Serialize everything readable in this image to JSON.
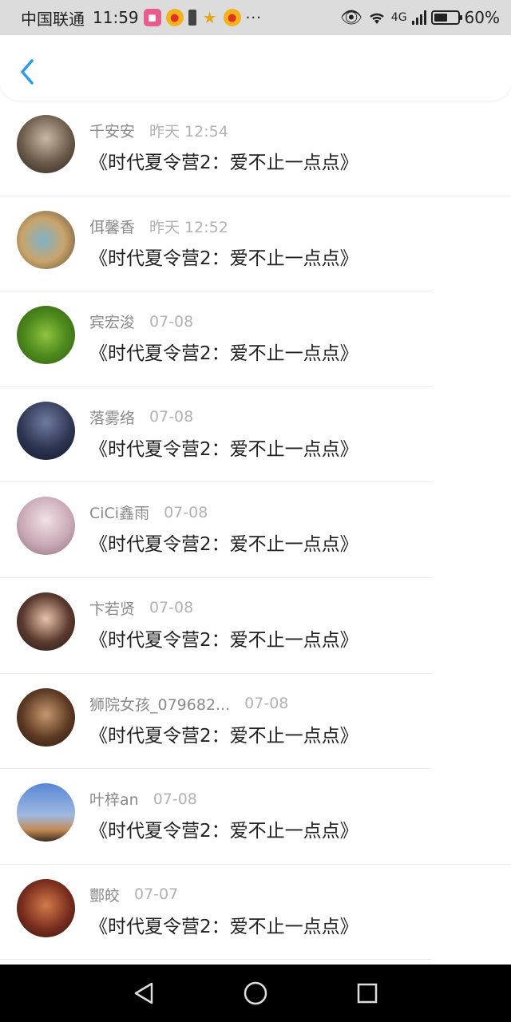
{
  "status_bar": {
    "carrier": "中国联通",
    "time": "11:59",
    "network": "4G",
    "battery_percent": 0.6,
    "battery_text": "60%",
    "more_dots": "···"
  },
  "header": {
    "back_icon": "chevron-left-icon",
    "accent_color": "#2d9be8"
  },
  "comments": [
    {
      "user": "千安安",
      "time": "昨天 12:54",
      "title": "《时代夏令营2：爱不止一点点》"
    },
    {
      "user": "佴馨香",
      "time": "昨天 12:52",
      "title": "《时代夏令营2：爱不止一点点》"
    },
    {
      "user": "宾宏浚",
      "time": "07-08",
      "title": "《时代夏令营2：爱不止一点点》"
    },
    {
      "user": "落雾络",
      "time": "07-08",
      "title": "《时代夏令营2：爱不止一点点》"
    },
    {
      "user": "CiCi鑫雨",
      "time": "07-08",
      "title": "《时代夏令营2：爱不止一点点》"
    },
    {
      "user": "卞若贤",
      "time": "07-08",
      "title": "《时代夏令营2：爱不止一点点》"
    },
    {
      "user": "狮院女孩_079682...",
      "time": "07-08",
      "title": "《时代夏令营2：爱不止一点点》"
    },
    {
      "user": "叶梓an",
      "time": "07-08",
      "title": "《时代夏令营2：爱不止一点点》"
    },
    {
      "user": "酆皎",
      "time": "07-07",
      "title": "《时代夏令营2：爱不止一点点》"
    }
  ],
  "nav_bar": {
    "back": "triangle-back-icon",
    "home": "circle-home-icon",
    "recents": "square-recents-icon"
  }
}
